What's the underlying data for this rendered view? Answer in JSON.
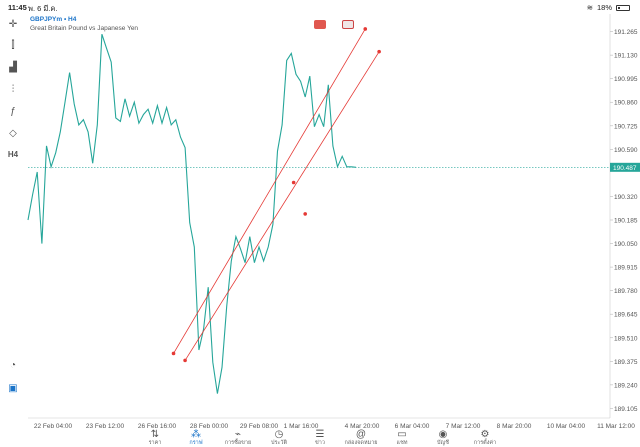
{
  "status_bar": {
    "time": "11:45",
    "date": "พ. 6 มี.ค.",
    "battery": "18%",
    "battery_level": 0.18
  },
  "chart": {
    "symbol": "GBPJPYm • H4",
    "description": "Great Britain Pound vs Japanese Yen",
    "current_price_label": "190.487",
    "colors": {
      "line": "#26a69a",
      "channel": "#e53935",
      "accent": "#1a73c8"
    }
  },
  "toolbar": {
    "icons": [
      "crosshair-icon",
      "candlestick-icon",
      "bar-chart-icon",
      "indicators-icon",
      "function-icon",
      "objects-icon",
      "timeframe-label"
    ],
    "timeframe": "H4"
  },
  "chart_data": {
    "type": "line",
    "title": "",
    "y_ticks": [
      "191.265",
      "191.130",
      "190.995",
      "190.860",
      "190.725",
      "190.590",
      "190.320",
      "190.185",
      "190.050",
      "189.915",
      "189.780",
      "189.645",
      "189.510",
      "189.375",
      "189.240",
      "189.105"
    ],
    "x_ticks": [
      "22 Feb 04:00",
      "23 Feb 12:00",
      "26 Feb 16:00",
      "28 Feb 00:00",
      "29 Feb 08:00",
      "1 Mar 16:00",
      "4 Mar 20:00",
      "6 Mar 04:00",
      "7 Mar 12:00",
      "8 Mar 20:00",
      "10 Mar 04:00",
      "11 Mar 12:00"
    ],
    "ylim": [
      189.05,
      191.32
    ],
    "series": [
      {
        "values": [
          190.185,
          190.33,
          190.46,
          190.05,
          190.61,
          190.49,
          190.57,
          190.69,
          190.86,
          191.03,
          190.85,
          190.73,
          190.76,
          190.69,
          190.51,
          190.73,
          191.25,
          191.17,
          191.09,
          190.77,
          190.75,
          190.88,
          190.78,
          190.86,
          190.74,
          190.79,
          190.82,
          190.74,
          190.84,
          190.74,
          190.83,
          190.73,
          190.76,
          190.66,
          190.6,
          190.17,
          190.03,
          189.44,
          189.56,
          189.8,
          189.37,
          189.19,
          189.34,
          189.69,
          189.95,
          190.09,
          190.02,
          189.94,
          190.09,
          189.94,
          190.03,
          189.95,
          190.03,
          190.16,
          190.58,
          190.73,
          191.1,
          191.14,
          191.02,
          190.98,
          190.89,
          191.01,
          190.72,
          190.79,
          190.72,
          190.96,
          190.61,
          190.49,
          190.55,
          190.49,
          190.49,
          190.487
        ],
        "x_index_step": 0.5
      }
    ],
    "current_price": 190.487,
    "channel_lines": [
      {
        "p1": {
          "xi": 31.5,
          "y": 189.42
        },
        "p2": {
          "xi": 57.5,
          "y": 190.4
        },
        "end": {
          "xi": 73.0,
          "y": 191.28
        }
      },
      {
        "p1": {
          "xi": 34.0,
          "y": 189.38
        },
        "p2": {
          "xi": 60.0,
          "y": 190.22
        },
        "end": {
          "xi": 76.0,
          "y": 191.15
        }
      }
    ],
    "grid": false
  },
  "nav": [
    {
      "name": "nav-quotes",
      "icon": "quotes-icon",
      "label": "ราคา",
      "glyph": "⇅"
    },
    {
      "name": "nav-chart",
      "icon": "chart-icon",
      "label": "กราฟ",
      "glyph": "⁂",
      "active": true
    },
    {
      "name": "nav-trade",
      "icon": "trade-icon",
      "label": "การซื้อขาย",
      "glyph": "⌁"
    },
    {
      "name": "nav-history",
      "icon": "history-icon",
      "label": "ประวัติ",
      "glyph": "◷"
    },
    {
      "name": "nav-news",
      "icon": "news-icon",
      "label": "ข่าว",
      "glyph": "☰"
    },
    {
      "name": "nav-mailbox",
      "icon": "mailbox-icon",
      "label": "กล่องจดหมาย",
      "glyph": "@"
    },
    {
      "name": "nav-chat",
      "icon": "chat-icon",
      "label": "แชท",
      "glyph": "▭"
    },
    {
      "name": "nav-account",
      "icon": "account-icon",
      "label": "บัญชี",
      "glyph": "◉"
    },
    {
      "name": "nav-settings",
      "icon": "settings-icon",
      "label": "การตั้งค่า",
      "glyph": "⚙"
    }
  ]
}
